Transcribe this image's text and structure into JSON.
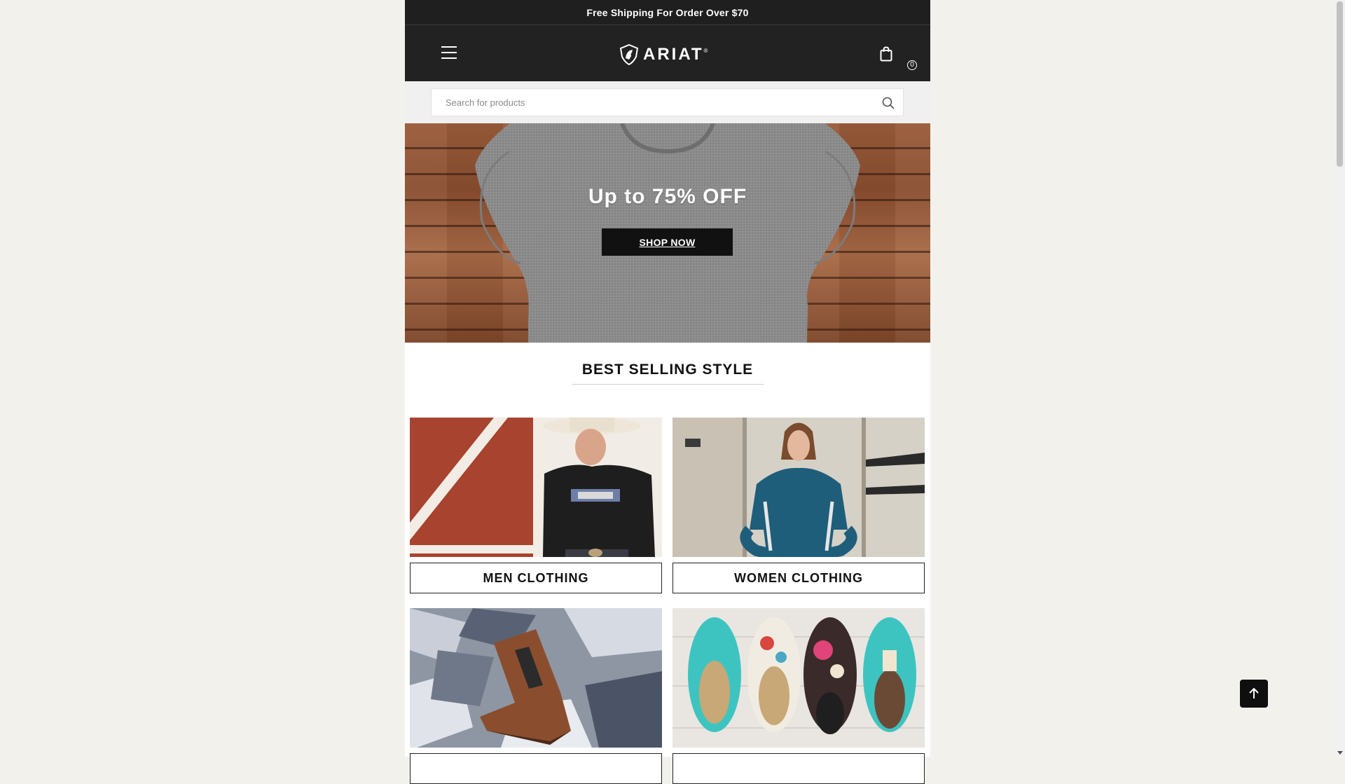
{
  "announcement": {
    "text": "Free Shipping For Order Over $70"
  },
  "header": {
    "logo_text": "ARIAT",
    "logo_mark": "®",
    "cart_count": "0",
    "icons": {
      "menu": "hamburger-menu-icon",
      "cart": "shopping-bag-icon"
    }
  },
  "search": {
    "placeholder": "Search for products",
    "value": "",
    "icon": "search-icon"
  },
  "hero": {
    "title": "Up to 75% OFF",
    "button_label": "SHOP NOW"
  },
  "best_selling": {
    "title": "BEST SELLING STYLE",
    "categories": [
      {
        "label": "MEN CLOTHING"
      },
      {
        "label": "WOMEN CLOTHING"
      },
      {
        "label": ""
      },
      {
        "label": ""
      }
    ]
  },
  "back_to_top": {
    "icon": "arrow-up-icon"
  },
  "colors": {
    "header_bg": "#222222",
    "announce_bg": "#1f1f1f",
    "page_bg": "#f3f1ec",
    "button_bg": "#111111"
  }
}
